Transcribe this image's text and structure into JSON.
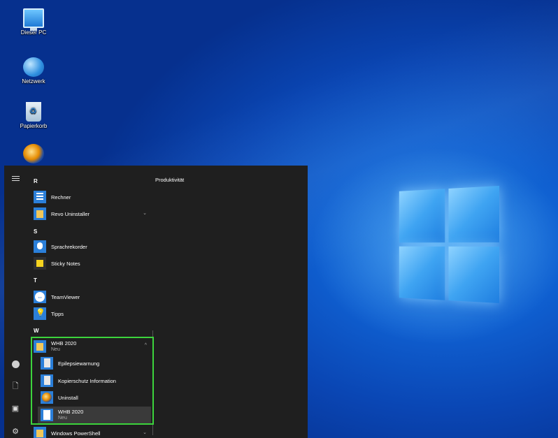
{
  "desktop": {
    "icons": [
      {
        "label": "Dieser PC",
        "icon": "computer-icon"
      },
      {
        "label": "Netzwerk",
        "icon": "network-icon"
      },
      {
        "label": "Papierkorb",
        "icon": "recycle-bin-icon"
      },
      {
        "label": "",
        "icon": "app-shortcut-icon"
      }
    ]
  },
  "start_menu": {
    "group_title": "Produktivität",
    "sections": [
      {
        "letter": "R",
        "apps": [
          {
            "label": "Rechner",
            "icon": "calculator-icon"
          },
          {
            "label": "Revo Uninstaller",
            "icon": "folder-icon",
            "chevron": "⌄"
          }
        ]
      },
      {
        "letter": "S",
        "apps": [
          {
            "label": "Sprachrekorder",
            "icon": "microphone-icon"
          },
          {
            "label": "Sticky Notes",
            "icon": "sticky-notes-icon"
          }
        ]
      },
      {
        "letter": "T",
        "apps": [
          {
            "label": "TeamViewer",
            "icon": "teamviewer-icon"
          },
          {
            "label": "Tipps",
            "icon": "tips-icon"
          }
        ]
      },
      {
        "letter": "W",
        "apps": [
          {
            "label": "WHB 2020",
            "sub": "Neu",
            "icon": "folder-icon",
            "chevron": "^"
          },
          {
            "label": "Epilepsiewarnung",
            "icon": "document-icon"
          },
          {
            "label": "Kopierschutz Information",
            "icon": "document-icon"
          },
          {
            "label": "Uninstall",
            "icon": "uninstall-icon"
          },
          {
            "label": "WHB 2020",
            "sub": "Neu",
            "icon": "app-icon"
          },
          {
            "label": "Windows PowerShell",
            "icon": "folder-icon",
            "chevron": "⌄"
          }
        ]
      }
    ]
  },
  "colors": {
    "highlight_border": "#3cd43c",
    "menu_bg": "#1f1f1f"
  }
}
